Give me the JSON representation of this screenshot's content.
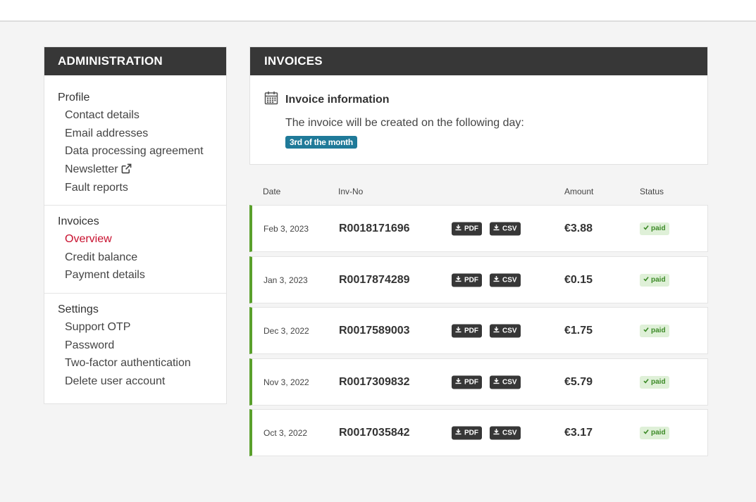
{
  "sidebar": {
    "title": "ADMINISTRATION",
    "groups": [
      {
        "heading": "Profile",
        "items": [
          {
            "label": "Contact details"
          },
          {
            "label": "Email addresses"
          },
          {
            "label": "Data processing agreement"
          },
          {
            "label": "Newsletter",
            "icon": "external-link-icon"
          },
          {
            "label": "Fault reports"
          }
        ]
      },
      {
        "heading": "Invoices",
        "items": [
          {
            "label": "Overview",
            "active": true
          },
          {
            "label": "Credit balance"
          },
          {
            "label": "Payment details"
          }
        ]
      },
      {
        "heading": "Settings",
        "items": [
          {
            "label": "Support OTP"
          },
          {
            "label": "Password"
          },
          {
            "label": "Two-factor authentication"
          },
          {
            "label": "Delete user account"
          }
        ]
      }
    ]
  },
  "main": {
    "title": "INVOICES",
    "info": {
      "icon": "calendar-icon",
      "title": "Invoice information",
      "text": "The invoice will be created on the following day:",
      "badge": "3rd of the month"
    },
    "table": {
      "headers": {
        "date": "Date",
        "inv_no": "Inv-No",
        "amount": "Amount",
        "status": "Status"
      },
      "pdf_label": "PDF",
      "csv_label": "CSV",
      "rows": [
        {
          "date": "Feb 3, 2023",
          "inv_no": "R0018171696",
          "amount": "€3.88",
          "status": "paid"
        },
        {
          "date": "Jan 3, 2023",
          "inv_no": "R0017874289",
          "amount": "€0.15",
          "status": "paid"
        },
        {
          "date": "Dec 3, 2022",
          "inv_no": "R0017589003",
          "amount": "€1.75",
          "status": "paid"
        },
        {
          "date": "Nov 3, 2022",
          "inv_no": "R0017309832",
          "amount": "€5.79",
          "status": "paid"
        },
        {
          "date": "Oct 3, 2022",
          "inv_no": "R0017035842",
          "amount": "€3.17",
          "status": "paid"
        }
      ]
    }
  },
  "colors": {
    "header_bg": "#373737",
    "active_link": "#c8102e",
    "row_accent": "#5aa02c",
    "badge_bg": "#1f7a99",
    "paid_bg": "#dff0d8",
    "paid_text": "#3c8a27"
  }
}
